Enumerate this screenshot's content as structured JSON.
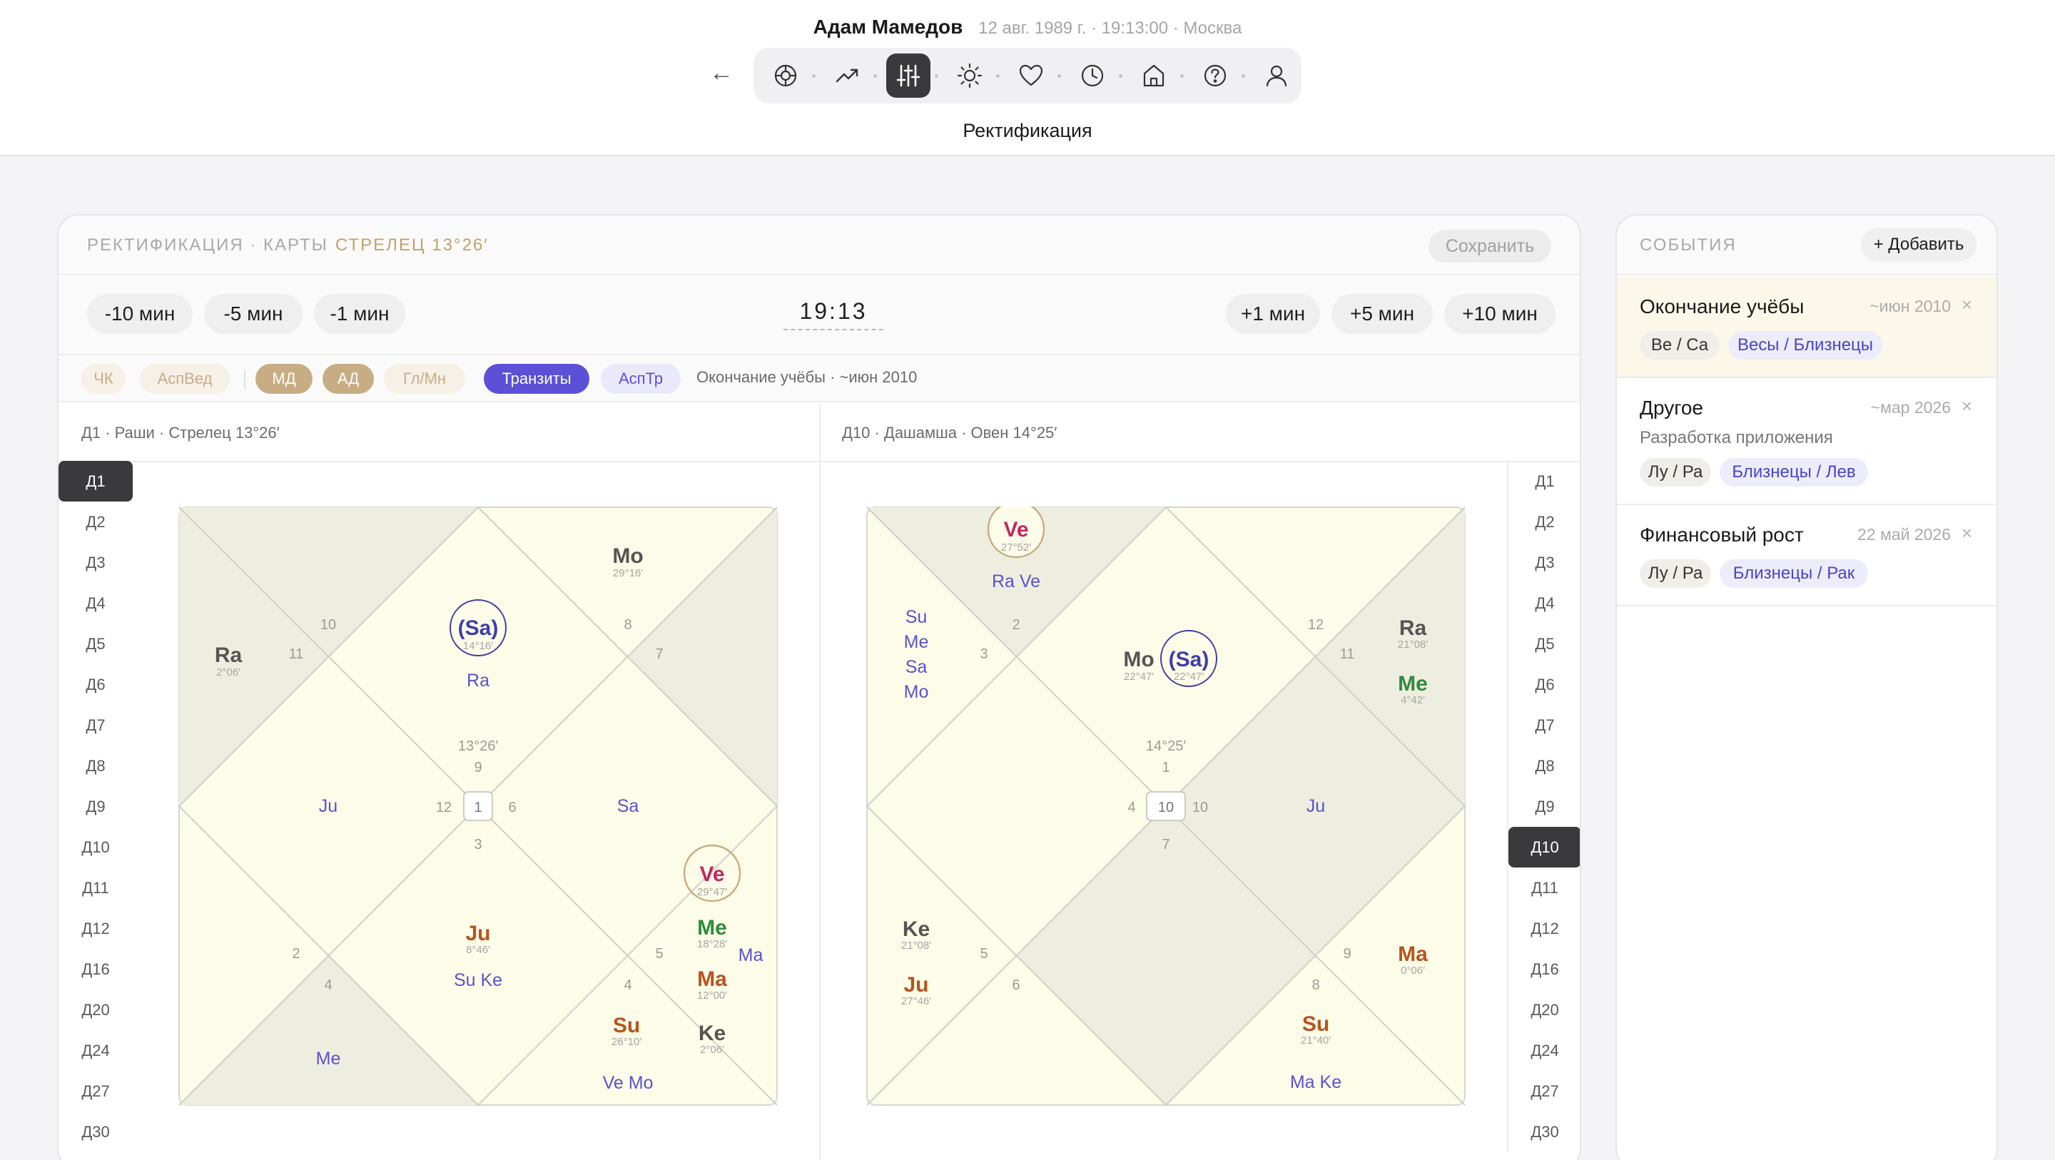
{
  "header": {
    "name": "Адам Мамедов",
    "meta": "12 авг. 1989 г. · 19:13:00 · Москва",
    "back": "←",
    "active_label": "Ректификация",
    "nav": [
      {
        "icon": "wheel-icon"
      },
      {
        "icon": "trend-icon"
      },
      {
        "icon": "sliders-icon",
        "active": true
      },
      {
        "icon": "sun-icon"
      },
      {
        "icon": "heart-icon"
      },
      {
        "icon": "clock-icon"
      },
      {
        "icon": "home-icon"
      },
      {
        "icon": "help-icon"
      },
      {
        "icon": "user-icon"
      }
    ]
  },
  "panel": {
    "label": "РЕКТИФИКАЦИЯ · КАРТЫ",
    "sign": "СТРЕЛЕЦ 13°26′",
    "save": "Сохранить",
    "minus": [
      "-10 мин",
      "-5 мин",
      "-1 мин"
    ],
    "time": "19:13",
    "plus": [
      "+1 мин",
      "+5 мин",
      "+10 мин"
    ],
    "chips": [
      "ЧК",
      "АспВед",
      "МД",
      "АД",
      "Гл/Мн",
      "Транзиты",
      "АспТр"
    ],
    "chips_note": "Окончание учёбы · ~июн 2010",
    "chart_left_title": "Д1 · Раши · Стрелец 13°26′",
    "chart_right_title": "Д10 · Дашамша · Овен 14°25′",
    "vargas": [
      "Д1",
      "Д2",
      "Д3",
      "Д4",
      "Д5",
      "Д6",
      "Д7",
      "Д8",
      "Д9",
      "Д10",
      "Д11",
      "Д12",
      "Д16",
      "Д20",
      "Д24",
      "Д27",
      "Д30"
    ],
    "varga_left_active": "Д1",
    "varga_right_active": "Д10"
  },
  "charts": {
    "left": {
      "asc_degree": "13°26′",
      "house_numbers": [
        "9",
        "10",
        "8",
        "11",
        "7",
        "12",
        "1",
        "6",
        "3",
        "2",
        "4",
        "5"
      ],
      "planets": [
        {
          "p": "Mo",
          "deg": "29°16′"
        },
        {
          "p": "(Sa)",
          "deg": "14°16′",
          "retro": true
        },
        {
          "p": "Ra",
          "deg": "2°06′"
        },
        {
          "p": "Ju",
          "deg": "8°46′"
        },
        {
          "p": "Ve",
          "deg": "29°47′",
          "combust": true
        },
        {
          "p": "Me",
          "deg": "18°28′"
        },
        {
          "p": "Ma",
          "deg": "12°00′"
        },
        {
          "p": "Su",
          "deg": "26°10′"
        },
        {
          "p": "Ke",
          "deg": "2°06′"
        }
      ],
      "transits": [
        "Ra",
        "Ju",
        "Sa",
        "Su Ke",
        "Ma",
        "Me",
        "Ve Mo"
      ]
    },
    "right": {
      "asc_degree": "14°25′",
      "house_numbers": [
        "1",
        "12",
        "2",
        "11",
        "3",
        "4",
        "10",
        "10",
        "7",
        "5",
        "9",
        "6",
        "8"
      ],
      "planets": [
        {
          "p": "Ve",
          "deg": "27°52′",
          "combust": true
        },
        {
          "p": "Mo",
          "deg": "22°47′"
        },
        {
          "p": "(Sa)",
          "deg": "22°47′",
          "retro": true
        },
        {
          "p": "Ra",
          "deg": "21°08′"
        },
        {
          "p": "Me",
          "deg": "4°42′"
        },
        {
          "p": "Ke",
          "deg": "21°08′"
        },
        {
          "p": "Ju",
          "deg": "27°46′"
        },
        {
          "p": "Ma",
          "deg": "0°06′"
        },
        {
          "p": "Su",
          "deg": "21°40′"
        }
      ],
      "transits": [
        "Ra Ve",
        "Su",
        "Me",
        "Sa",
        "Mo",
        "Ju",
        "Ma Ke"
      ]
    }
  },
  "events": {
    "label": "СОБЫТИЯ",
    "add": "+ Добавить",
    "close": "×",
    "items": [
      {
        "title": "Окончание учёбы",
        "date": "~июн 2010",
        "sub": "",
        "tag1": "Ве / Са",
        "tag2": "Весы / Близнецы",
        "selected": true
      },
      {
        "title": "Другое",
        "date": "~мар 2026",
        "sub": "Разработка приложения",
        "tag1": "Лу / Ра",
        "tag2": "Близнецы / Лев",
        "selected": false
      },
      {
        "title": "Финансовый рост",
        "date": "22 май 2026",
        "sub": "",
        "tag1": "Лу / Ра",
        "tag2": "Близнецы / Рак",
        "selected": false
      }
    ]
  },
  "colors": {
    "accent_gold": "#c8ad84",
    "transit_purple": "#5b50d6",
    "chart_bg": "#fdfce8",
    "chart_shade": "#eeeee0",
    "retro_blue": "#3f3fa8",
    "combust_pink": "#c2285f",
    "green": "#2e8b3e",
    "orange": "#b4561f",
    "transit_text": "#5a52d0"
  }
}
